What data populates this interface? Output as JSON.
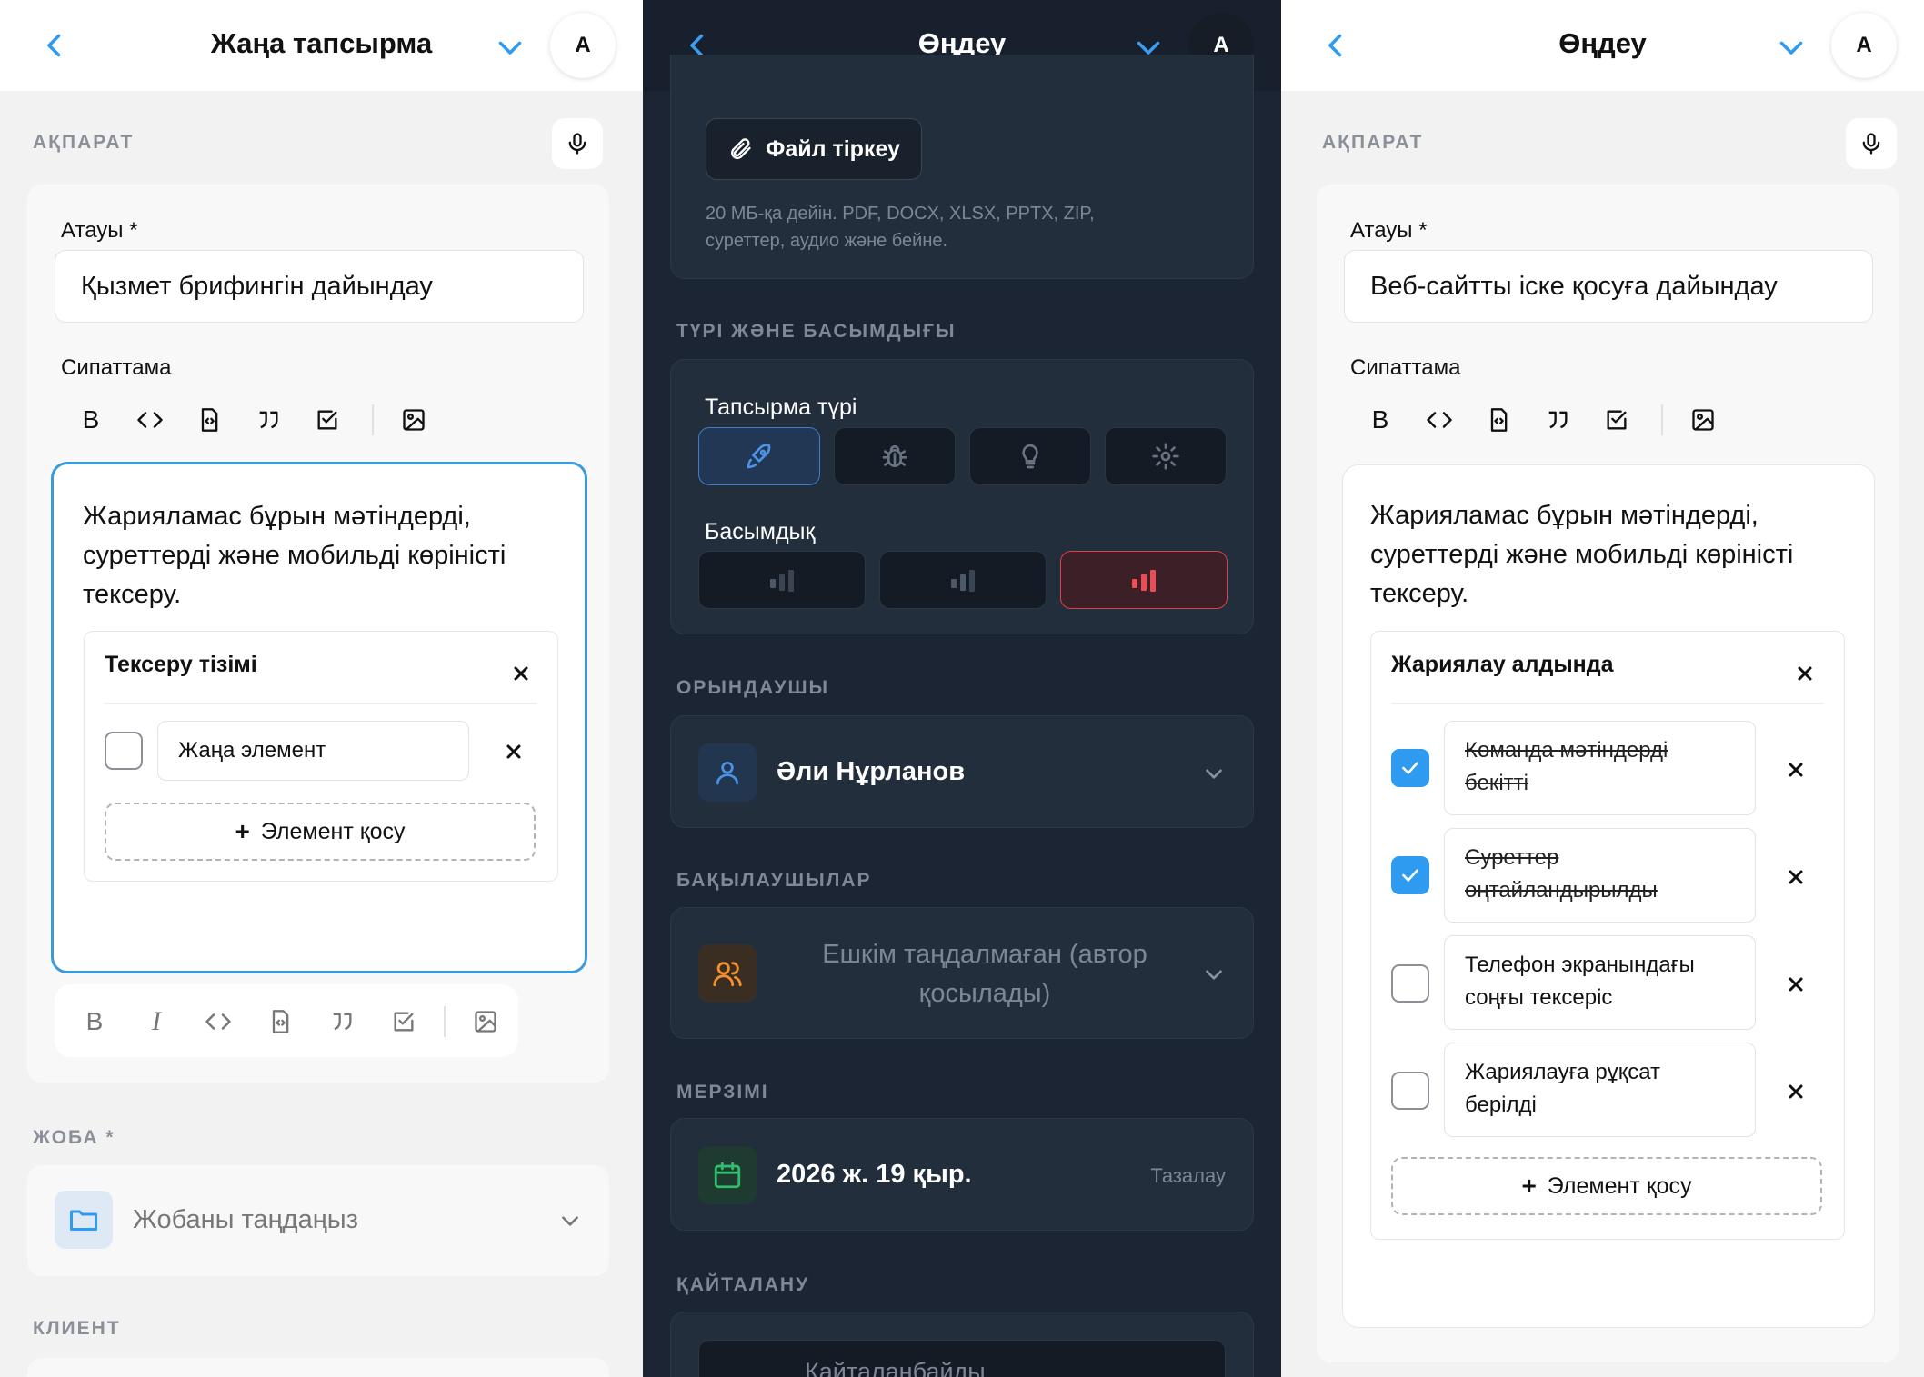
{
  "screen1": {
    "header": {
      "title": "Жаңа тапсырма",
      "avatar": "A"
    },
    "section_info": "АҚПАРАТ",
    "name_label": "Атауы *",
    "name_value": "Қызмет брифингін дайындау",
    "desc_label": "Сипаттама",
    "editor_text": "Жарияламас бұрын мәтіндерді, суреттерді және мобильді көріністі тексеру.",
    "checklist": {
      "title": "Тексеру тізімі",
      "item_placeholder": "Жаңа элемент",
      "add_label": "Элемент қосу"
    },
    "section_project": "ЖОБА *",
    "project_placeholder": "Жобаны таңдаңыз",
    "section_client": "КЛИЕНТ"
  },
  "screen2": {
    "header": {
      "title": "Өңдеу",
      "avatar": "A"
    },
    "attach_label": "Файл тіркеу",
    "attach_hint": "20 МБ-қа дейін. PDF, DOCX, XLSX, PPTX, ZIP, суреттер, аудио және бейне.",
    "section_type_priority": "ТҮРІ ЖӘНЕ БАСЫМДЫҒЫ",
    "task_type_label": "Тапсырма түрі",
    "task_types": [
      "rocket-icon",
      "bug-icon",
      "lightbulb-icon",
      "gear-icon"
    ],
    "priority_label": "Басымдық",
    "priorities": [
      "low",
      "medium",
      "high"
    ],
    "selected_priority": "high",
    "section_assignee": "ОРЫНДАУШЫ",
    "assignee": "Әли Нұрланов",
    "section_watchers": "БАҚЫЛАУШЫЛАР",
    "watchers_placeholder": "Ешкім таңдалмаған (автор қосылады)",
    "section_deadline": "МЕРЗІМІ",
    "deadline": "2026 ж. 19 қыр.",
    "clear_label": "Тазалау",
    "section_repeat": "ҚАЙТАЛАНУ",
    "repeat_value": "Қайталанбайды"
  },
  "screen3": {
    "header": {
      "title": "Өңдеу",
      "avatar": "A"
    },
    "section_info": "АҚПАРАТ",
    "name_label": "Атауы *",
    "name_value": "Веб-сайтты іске қосуға дайындау",
    "desc_label": "Сипаттама",
    "editor_text": "Жарияламас бұрын мәтіндерді, суреттерді және мобильді көріністі тексеру.",
    "checklist": {
      "title": "Жариялау алдында",
      "items": [
        {
          "text": "Команда мәтіндерді бекітті",
          "done": true
        },
        {
          "text": "Суреттер оңтайландырылды",
          "done": true
        },
        {
          "text": "Телефон экранындағы соңғы тексеріс",
          "done": false
        },
        {
          "text": "Жариялауға рұқсат берілді",
          "done": false
        }
      ],
      "add_label": "Элемент қосу"
    }
  },
  "colors": {
    "accent": "#2f9bf0",
    "danger": "#e5454d",
    "dark_bg": "#1c2533",
    "light_bg": "#f2f2f3"
  }
}
